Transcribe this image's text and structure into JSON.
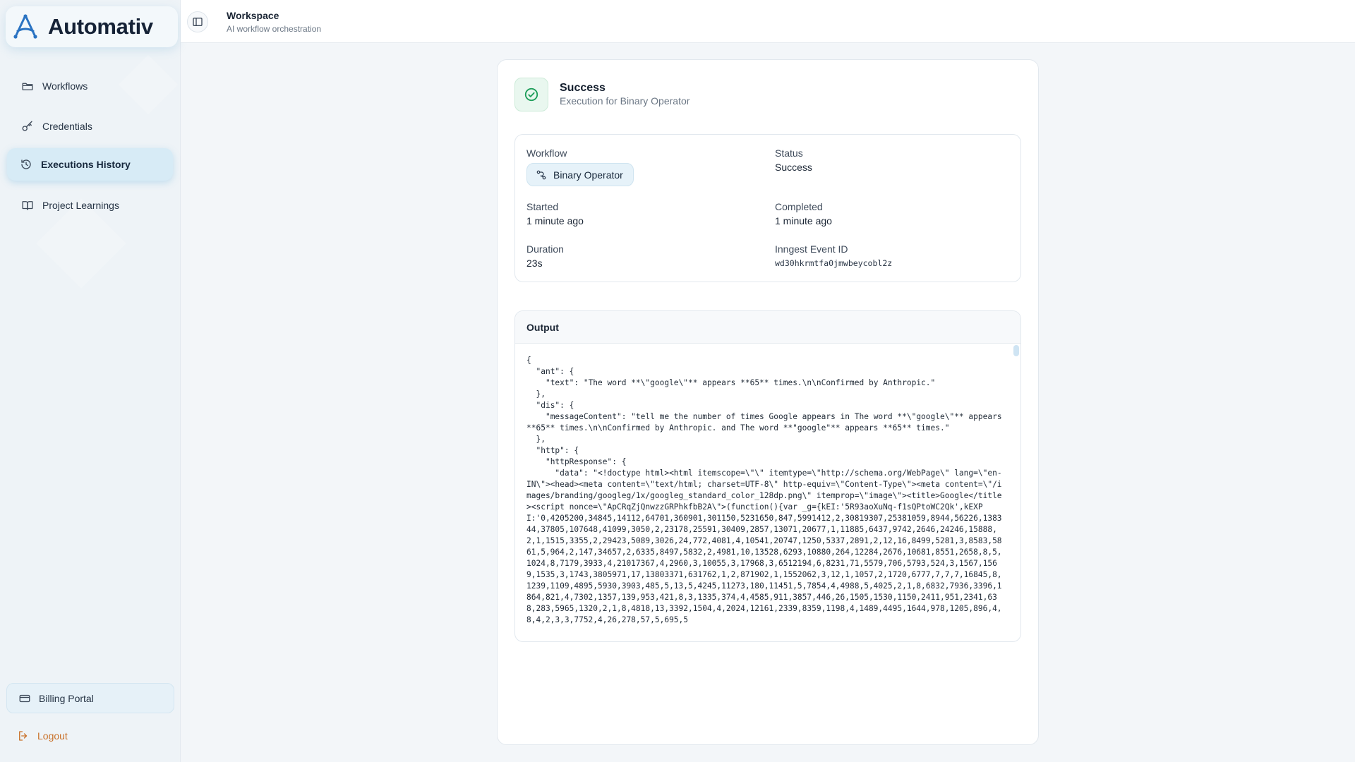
{
  "brand": {
    "name": "Automativ"
  },
  "sidebar": {
    "items": [
      {
        "label": "Workflows",
        "icon": "folder-icon"
      },
      {
        "label": "Credentials",
        "icon": "key-icon"
      },
      {
        "label": "Executions History",
        "icon": "history-icon",
        "active": true
      },
      {
        "label": "Project Learnings",
        "icon": "book-icon"
      }
    ],
    "billing_label": "Billing Portal",
    "logout_label": "Logout"
  },
  "header": {
    "title": "Workspace",
    "subtitle": "AI workflow orchestration"
  },
  "execution": {
    "status_title": "Success",
    "status_subtitle": "Execution for Binary Operator",
    "workflow_label": "Workflow",
    "workflow_name": "Binary Operator",
    "status_label": "Status",
    "status_value": "Success",
    "started_label": "Started",
    "started_value": "1 minute ago",
    "completed_label": "Completed",
    "completed_value": "1 minute ago",
    "duration_label": "Duration",
    "duration_value": "23s",
    "event_id_label": "Inngest Event ID",
    "event_id_value": "wd30hkrmtfa0jmwbeycobl2z"
  },
  "output": {
    "title": "Output",
    "content": "{\n  \"ant\": {\n    \"text\": \"The word **\\\"google\\\"** appears **65** times.\\n\\nConfirmed by Anthropic.\"\n  },\n  \"dis\": {\n    \"messageContent\": \"tell me the number of times Google appears in The word **\\\"google\\\"** appears **65** times.\\n\\nConfirmed by Anthropic. and The word **\"google\"** appears **65** times.\"\n  },\n  \"http\": {\n    \"httpResponse\": {\n      \"data\": \"<!doctype html><html itemscope=\\\"\\\" itemtype=\\\"http://schema.org/WebPage\\\" lang=\\\"en-IN\\\"><head><meta content=\\\"text/html; charset=UTF-8\\\" http-equiv=\\\"Content-Type\\\"><meta content=\\\"/images/branding/googleg/1x/googleg_standard_color_128dp.png\\\" itemprop=\\\"image\\\"><title>Google</title><script nonce=\\\"ApCRqZjQnwzzGRPhkfbB2A\\\">(function(){var _g={kEI:'5R93aoXuNq-f1sQPtoWC2Qk',kEXPI:'0,4205200,34845,14112,64701,360901,301150,5231650,847,5991412,2,30819307,25381059,8944,56226,138344,37805,107648,41099,3050,2,23178,25591,30409,2857,13071,20677,1,11885,6437,9742,2646,24246,15888,2,1,1515,3355,2,29423,5089,3026,24,772,4081,4,10541,20747,1250,5337,2891,2,12,16,8499,5281,3,8583,5861,5,964,2,147,34657,2,6335,8497,5832,2,4981,10,13528,6293,10880,264,12284,2676,10681,8551,2658,8,5,1024,8,7179,3933,4,21017367,4,2960,3,10055,3,17968,3,6512194,6,8231,71,5579,706,5793,524,3,1567,1569,1535,3,1743,3805971,17,13803371,631762,1,2,871902,1,1552062,3,12,1,1057,2,1720,6777,7,7,7,16845,8,1239,1109,4895,5930,3903,485,5,13,5,4245,11273,180,11451,5,7854,4,4988,5,4025,2,1,8,6832,7936,3396,1864,821,4,7302,1357,139,953,421,8,3,1335,374,4,4585,911,3857,446,26,1505,1530,1150,2411,951,2341,638,283,5965,1320,2,1,8,4818,13,3392,1504,4,2024,12161,2339,8359,1198,4,1489,4495,1644,978,1205,896,4,8,4,2,3,3,7752,4,26,278,57,5,695,5"
  }
}
